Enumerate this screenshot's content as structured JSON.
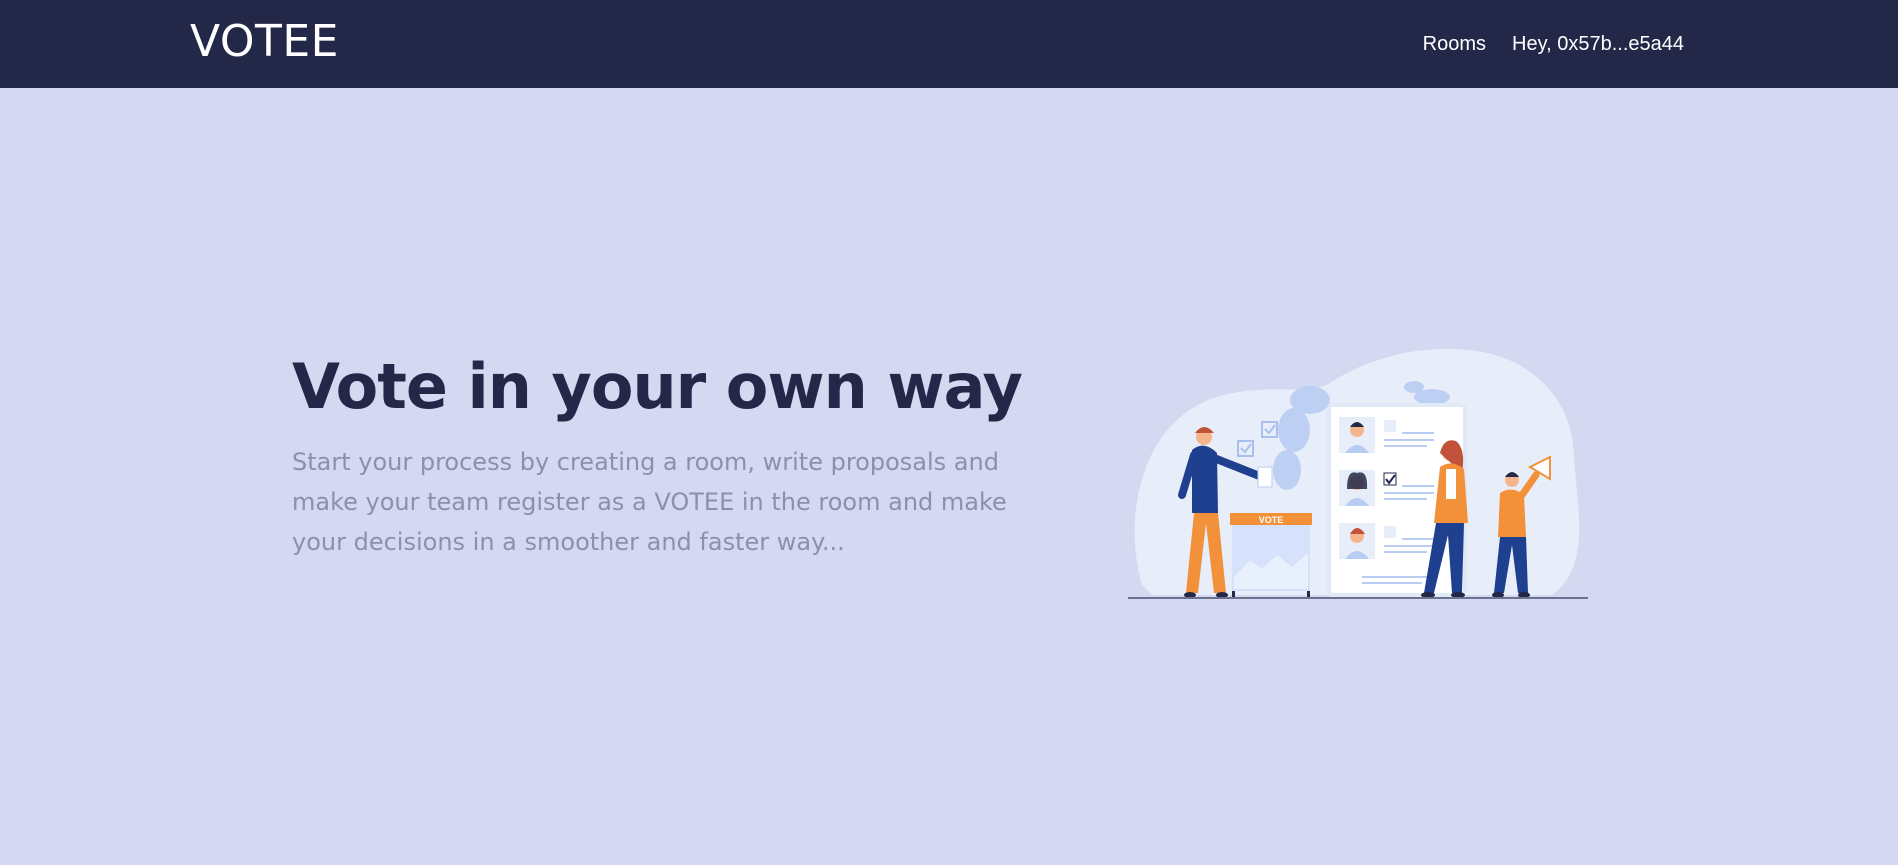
{
  "header": {
    "logo": "VOTEE",
    "nav": {
      "rooms_label": "Rooms",
      "account_label": "Hey, 0x57b...e5a44"
    }
  },
  "hero": {
    "title": "Vote in your own way",
    "description": "Start your process by creating a room, write proposals and make your team register as a VOTEE in the room and make your decisions in a smoother and faster way...",
    "illustration": {
      "icon": "voting-illustration",
      "ballot_box_label": "VOTE"
    }
  },
  "colors": {
    "navbar_bg": "#232849",
    "page_bg": "#d4d8f1",
    "title": "#232849",
    "description": "#8c90aa",
    "accent_orange": "#f3913a",
    "accent_blue": "#1f3f8f"
  }
}
